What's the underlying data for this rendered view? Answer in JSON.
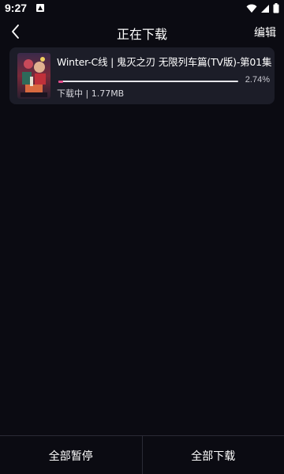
{
  "status_bar": {
    "time": "9:27",
    "notification_icon": "a-notification-icon",
    "icons": [
      "wifi-icon",
      "signal-icon",
      "battery-icon"
    ]
  },
  "header": {
    "title": "正在下载",
    "edit_label": "编辑",
    "back_icon": "chevron-left-icon"
  },
  "downloads": [
    {
      "title": "Winter-C线 | 鬼灭之刃 无限列车篇(TV版)-第01集",
      "progress_percent": 2.74,
      "progress_text": "2.74%",
      "status_text": "下载中 | 1.77MB"
    }
  ],
  "bottom_bar": {
    "pause_all_label": "全部暂停",
    "download_all_label": "全部下载"
  },
  "colors": {
    "background": "#0b0b12",
    "card": "#1c1d28",
    "accent": "#e24a8a"
  }
}
